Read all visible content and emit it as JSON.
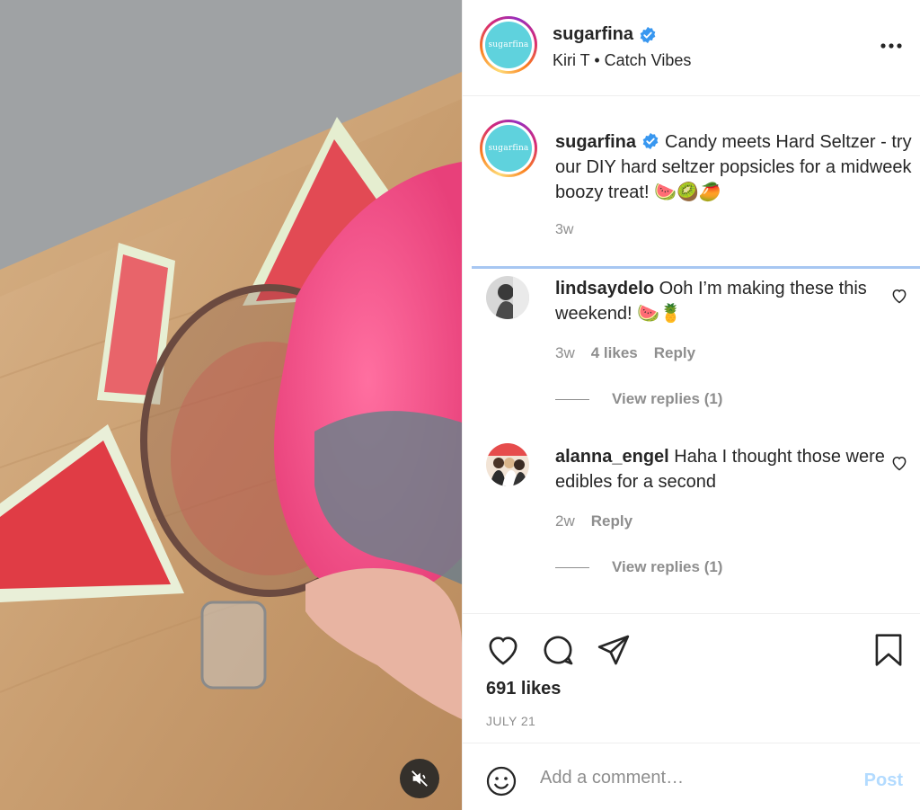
{
  "post": {
    "username": "sugarfina",
    "verified": true,
    "avatar_logo_text": "sugarfina",
    "subtitle": "Kiri T • Catch Vibes",
    "caption": "Candy meets Hard Seltzer - try our DIY hard seltzer popsicles for a midweek boozy treat! 🍉🥝🥭",
    "caption_time": "3w"
  },
  "comments": [
    {
      "username": "lindsaydelo",
      "text": "Ooh I’m making these this weekend! 🍉🍍",
      "time": "3w",
      "likes": "4 likes",
      "reply_label": "Reply",
      "view_replies": "View replies (1)"
    },
    {
      "username": "alanna_engel",
      "text": "Haha I thought those were edibles for a second",
      "time": "2w",
      "reply_label": "Reply",
      "view_replies": "View replies (1)"
    }
  ],
  "stats": {
    "likes": "691 likes",
    "date": "JULY 21"
  },
  "add_comment": {
    "placeholder": "Add a comment…",
    "post_label": "Post"
  },
  "colors": {
    "accent_blue": "#0095f6",
    "post_disabled": "#b3dbff",
    "verified": "#3897f0",
    "logo_teal": "#5fd2dd"
  },
  "icons": {
    "more": "more-horizontal-icon",
    "heart": "heart-icon",
    "comment": "comment-icon",
    "share": "share-icon",
    "save": "bookmark-icon",
    "emoji": "emoji-icon",
    "mute": "muted-speaker-icon"
  }
}
